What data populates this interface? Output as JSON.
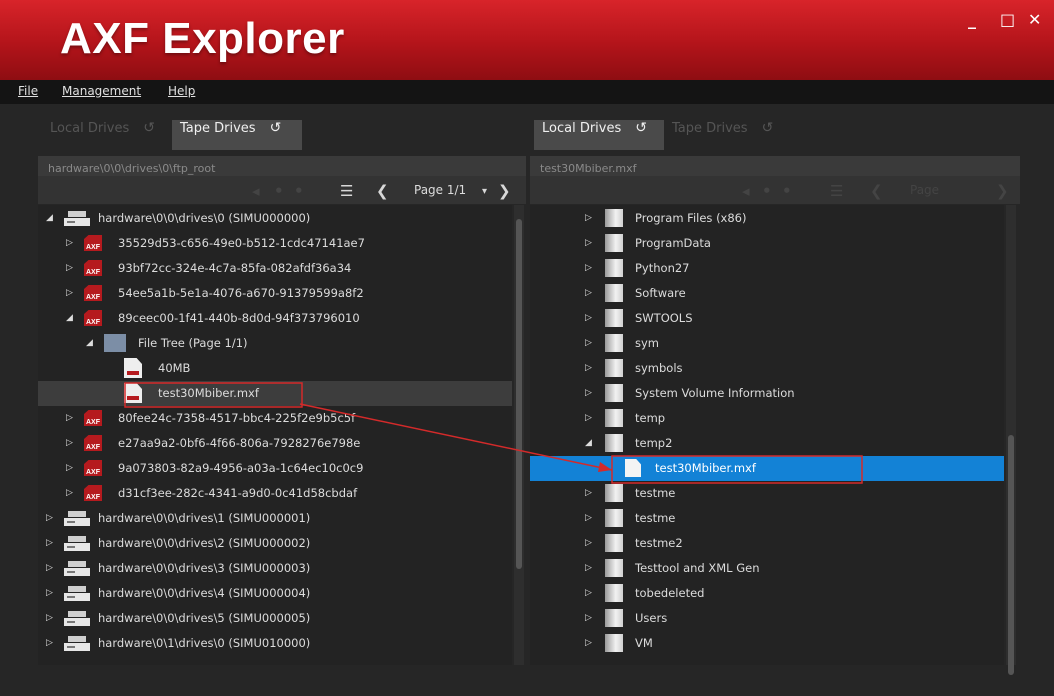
{
  "app": {
    "title": "AXF Explorer"
  },
  "window_controls": {
    "minimize": "_",
    "maximize": "□",
    "close": "✕"
  },
  "menu": {
    "file": "File",
    "management": "Management",
    "help": "Help"
  },
  "left": {
    "tabs": [
      {
        "label": "Local Drives",
        "active": false
      },
      {
        "label": "Tape Drives",
        "active": true
      }
    ],
    "path": "hardware\\0\\0\\drives\\0\\ftp_root",
    "page_label": "Page 1/1",
    "rows": [
      {
        "label": "hardware\\0\\0\\drives\\0 (SIMU000000)",
        "icon": "drive-icon",
        "arrow": "expanded"
      },
      {
        "label": "35529d53-c656-49e0-b512-1cdc47141ae7",
        "icon": "axf-icon",
        "arrow": "collapsed"
      },
      {
        "label": "93bf72cc-324e-4c7a-85fa-082afdf36a34",
        "icon": "axf-icon",
        "arrow": "collapsed"
      },
      {
        "label": "54ee5a1b-5e1a-4076-a670-91379599a8f2",
        "icon": "axf-icon",
        "arrow": "collapsed"
      },
      {
        "label": "89ceec00-1f41-440b-8d0d-94f373796010",
        "icon": "axf-icon",
        "arrow": "expanded"
      },
      {
        "label": "File Tree (Page 1/1)",
        "icon": "file-tree-icon",
        "arrow": "expanded"
      },
      {
        "label": "40MB",
        "icon": "mxf-file-icon",
        "arrow": ""
      },
      {
        "label": "test30Mbiber.mxf",
        "icon": "mxf-file-icon",
        "arrow": ""
      },
      {
        "label": "80fee24c-7358-4517-bbc4-225f2e9b5c5f",
        "icon": "axf-icon",
        "arrow": "collapsed"
      },
      {
        "label": "e27aa9a2-0bf6-4f66-806a-7928276e798e",
        "icon": "axf-icon",
        "arrow": "collapsed"
      },
      {
        "label": "9a073803-82a9-4956-a03a-1c64ec10c0c9",
        "icon": "axf-icon",
        "arrow": "collapsed"
      },
      {
        "label": "d31cf3ee-282c-4341-a9d0-0c41d58cbdaf",
        "icon": "axf-icon",
        "arrow": "collapsed"
      },
      {
        "label": "hardware\\0\\0\\drives\\1 (SIMU000001)",
        "icon": "drive-icon",
        "arrow": "collapsed"
      },
      {
        "label": "hardware\\0\\0\\drives\\2 (SIMU000002)",
        "icon": "drive-icon",
        "arrow": "collapsed"
      },
      {
        "label": "hardware\\0\\0\\drives\\3 (SIMU000003)",
        "icon": "drive-icon",
        "arrow": "collapsed"
      },
      {
        "label": "hardware\\0\\0\\drives\\4 (SIMU000004)",
        "icon": "drive-icon",
        "arrow": "collapsed"
      },
      {
        "label": "hardware\\0\\0\\drives\\5 (SIMU000005)",
        "icon": "drive-icon",
        "arrow": "collapsed"
      },
      {
        "label": "hardware\\0\\1\\drives\\0 (SIMU010000)",
        "icon": "drive-icon",
        "arrow": "collapsed"
      }
    ]
  },
  "right": {
    "tabs": [
      {
        "label": "Local Drives",
        "active": true
      },
      {
        "label": "Tape Drives",
        "active": false
      }
    ],
    "path": "test30Mbiber.mxf",
    "page_label": "Page",
    "rows": [
      {
        "label": "Program Files (x86)",
        "icon": "folder-icon",
        "arrow": "collapsed"
      },
      {
        "label": "ProgramData",
        "icon": "folder-icon",
        "arrow": "collapsed"
      },
      {
        "label": "Python27",
        "icon": "folder-icon",
        "arrow": "collapsed"
      },
      {
        "label": "Software",
        "icon": "folder-icon",
        "arrow": "collapsed"
      },
      {
        "label": "SWTOOLS",
        "icon": "folder-icon",
        "arrow": "collapsed"
      },
      {
        "label": "sym",
        "icon": "folder-icon",
        "arrow": "collapsed"
      },
      {
        "label": "symbols",
        "icon": "folder-icon",
        "arrow": "collapsed"
      },
      {
        "label": "System Volume Information",
        "icon": "folder-icon",
        "arrow": "collapsed"
      },
      {
        "label": "temp",
        "icon": "folder-icon",
        "arrow": "collapsed"
      },
      {
        "label": "temp2",
        "icon": "folder-icon",
        "arrow": "expanded"
      },
      {
        "label": "test30Mbiber.mxf",
        "icon": "file-icon",
        "arrow": ""
      },
      {
        "label": "testme",
        "icon": "folder-icon",
        "arrow": "collapsed"
      },
      {
        "label": "testme",
        "icon": "folder-icon",
        "arrow": "collapsed"
      },
      {
        "label": "testme2",
        "icon": "folder-icon",
        "arrow": "collapsed"
      },
      {
        "label": "Testtool and XML Gen",
        "icon": "folder-icon",
        "arrow": "collapsed"
      },
      {
        "label": "tobedeleted",
        "icon": "folder-icon",
        "arrow": "collapsed"
      },
      {
        "label": "Users",
        "icon": "folder-icon",
        "arrow": "collapsed"
      },
      {
        "label": "VM",
        "icon": "folder-icon",
        "arrow": "collapsed"
      }
    ]
  },
  "colors": {
    "title_red": "#c41c22",
    "selection_blue": "#1382d6",
    "annotation_red": "#d42a2a"
  }
}
